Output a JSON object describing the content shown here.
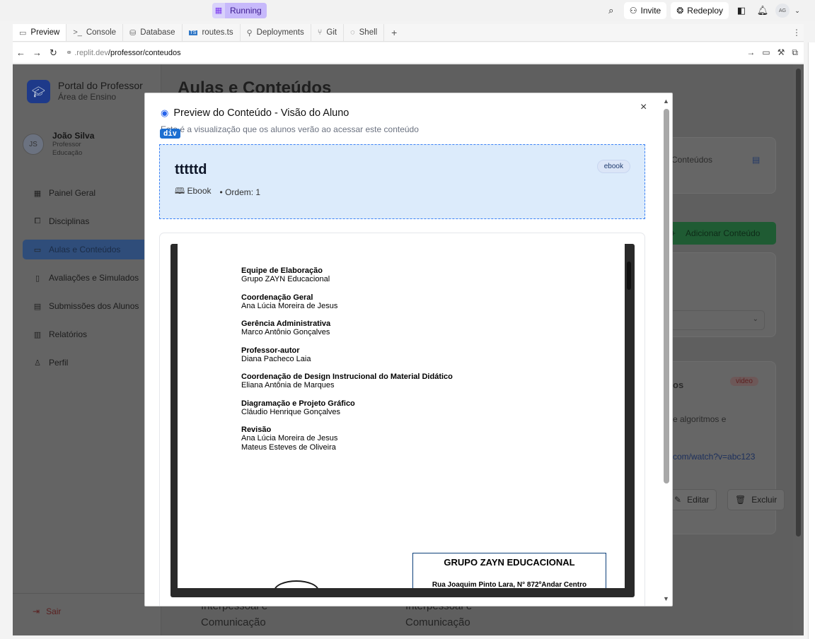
{
  "topbar": {
    "running_label": "Running",
    "invite_label": "Invite",
    "redeploy_label": "Redeploy",
    "avatar_initials": "AG"
  },
  "tabs": [
    {
      "label": "Preview",
      "icon": "preview-icon"
    },
    {
      "label": "Console",
      "icon": "console-icon"
    },
    {
      "label": "Database",
      "icon": "database-icon"
    },
    {
      "label": "routes.ts",
      "icon": "ts-file-icon"
    },
    {
      "label": "Deployments",
      "icon": "deployments-icon"
    },
    {
      "label": "Git",
      "icon": "git-icon"
    },
    {
      "label": "Shell",
      "icon": "shell-icon"
    }
  ],
  "url": {
    "domain": ".replit.dev",
    "path": "/professor/conteudos"
  },
  "sidebar": {
    "title": "Portal do Professor",
    "subtitle": "Área de Ensino",
    "user_initials": "JS",
    "user_name": "João Silva",
    "user_role": "Professor",
    "user_area": "Educação",
    "items": [
      {
        "label": "Painel Geral"
      },
      {
        "label": "Disciplinas"
      },
      {
        "label": "Aulas e Conteúdos"
      },
      {
        "label": "Avaliações e Simulados"
      },
      {
        "label": "Submissões dos Alunos"
      },
      {
        "label": "Relatórios"
      },
      {
        "label": "Perfil"
      }
    ],
    "logout": "Sair"
  },
  "main": {
    "title": "Aulas e Conteúdos",
    "card_conteudos": "Conteúdos",
    "add_button": "Adicionar Conteúdo",
    "item_title_fragment": "os",
    "item_badge": "video",
    "item_desc_fragment": "e algoritmos e",
    "item_link_fragment": "com/watch?v=abc123",
    "edit_button": "Editar",
    "delete_button": "Excluir",
    "bottom_left": [
      "Interpessoal e",
      "Comunicação"
    ],
    "bottom_right": [
      "Interpessoal e",
      "Comunicação"
    ]
  },
  "modal": {
    "title": "Preview do Conteúdo - Visão do Aluno",
    "subtitle": "Esta é a visualização que os alunos verão ao acessar este conteúdo",
    "inspector_tag": "div",
    "content_title": "tttttd",
    "content_type": "Ebook",
    "content_order": "• Ordem: 1",
    "badge": "ebook"
  },
  "document": {
    "credits": [
      {
        "role": "Equipe de Elaboração",
        "names": [
          "Grupo ZAYN Educacional"
        ]
      },
      {
        "role": "Coordenação Geral",
        "names": [
          "Ana Lúcia Moreira de Jesus"
        ]
      },
      {
        "role": "Gerência Administrativa",
        "names": [
          "Marco Antônio Gonçalves"
        ]
      },
      {
        "role": "Professor-autor",
        "names": [
          "Diana Pacheco Laia"
        ]
      },
      {
        "role": "Coordenação de Design Instrucional do Material Didático",
        "names": [
          "Eliana Antônia de Marques"
        ]
      },
      {
        "role": "Diagramação e Projeto Gráfico",
        "names": [
          "Cláudio Henrique Gonçalves"
        ]
      },
      {
        "role": "Revisão",
        "names": [
          "Ana Lúcia Moreira de Jesus",
          "Mateus Esteves de Oliveira"
        ]
      }
    ],
    "publisher": "GRUPO ZAYN EDUCACIONAL",
    "address": "Rua Joaquim Pinto Lara, N° 872ºAndar Centro"
  }
}
